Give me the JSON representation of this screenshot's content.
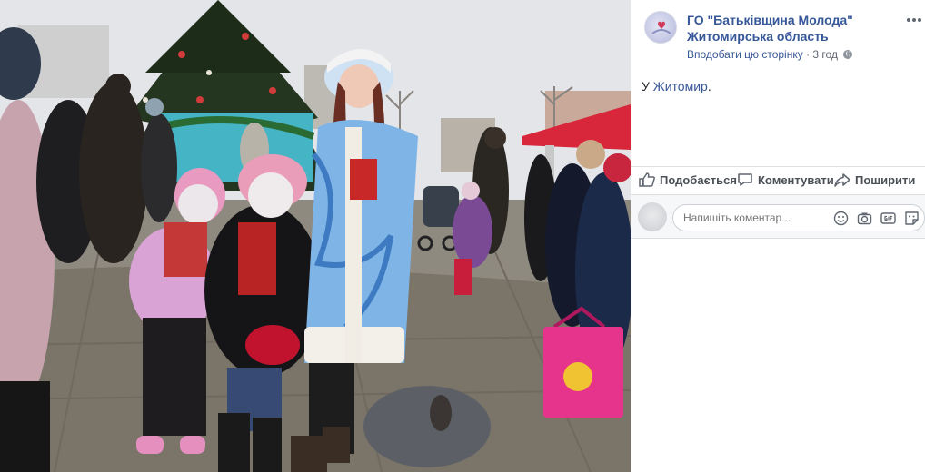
{
  "post": {
    "page_name": "ГО \"Батьківщина Молода\" Житомирська область",
    "like_page_link": "Вподобати цю сторінку",
    "separator": "·",
    "time": "3 год",
    "text_prefix": "У ",
    "place": "Житомир",
    "text_suffix": "."
  },
  "actions": {
    "like": "Подобається",
    "comment": "Коментувати",
    "share": "Поширити"
  },
  "comment_box": {
    "placeholder": "Напишіть коментар..."
  },
  "icons": [
    "more-icon",
    "globe-icon",
    "like-icon",
    "comment-icon",
    "share-icon",
    "emoji-icon",
    "camera-icon",
    "gif-icon",
    "sticker-icon"
  ],
  "colors": {
    "link": "#365899",
    "action_text": "#4b4f56",
    "meta_text": "#616770",
    "divider": "#dddfe2"
  }
}
